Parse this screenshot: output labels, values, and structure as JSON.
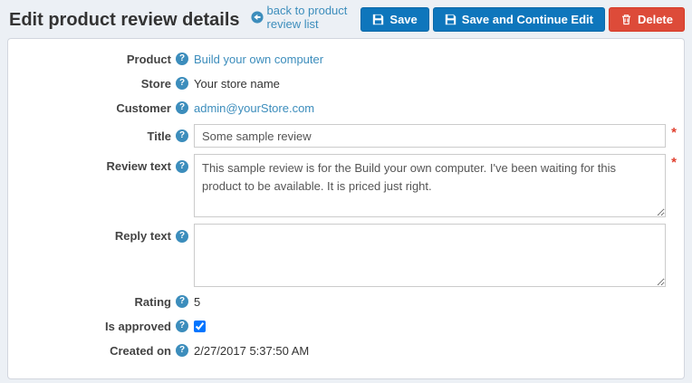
{
  "header": {
    "title": "Edit product review details",
    "back_link_label": "back to product review list"
  },
  "toolbar": {
    "save_label": "Save",
    "save_continue_label": "Save and Continue Edit",
    "delete_label": "Delete"
  },
  "icons": {
    "help_glyph": "?"
  },
  "form": {
    "required_marker": "*",
    "product": {
      "label": "Product",
      "value": "Build your own computer"
    },
    "store": {
      "label": "Store",
      "value": "Your store name"
    },
    "customer": {
      "label": "Customer",
      "value": "admin@yourStore.com"
    },
    "title": {
      "label": "Title",
      "value": "Some sample review"
    },
    "review_text": {
      "label": "Review text",
      "value": "This sample review is for the Build your own computer. I've been waiting for this product to be available. It is priced just right."
    },
    "reply_text": {
      "label": "Reply text",
      "value": ""
    },
    "rating": {
      "label": "Rating",
      "value": "5"
    },
    "is_approved": {
      "label": "Is approved",
      "checked_attr": "checked"
    },
    "created_on": {
      "label": "Created on",
      "value": "2/27/2017 5:37:50 AM"
    }
  },
  "colors": {
    "page_background": "#ecf0f5",
    "primary_button": "#0e76bc",
    "danger_button": "#dd4b39",
    "link": "#3c8dbc",
    "required": "#e0402f",
    "panel_border": "#d2d6de"
  }
}
